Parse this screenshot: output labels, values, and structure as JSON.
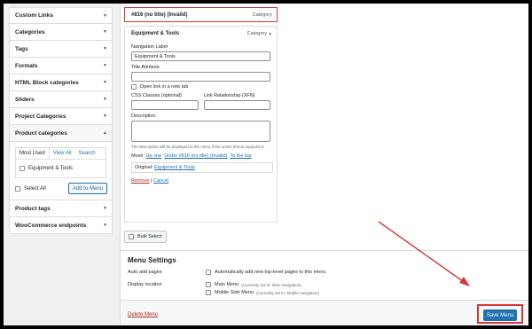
{
  "left_panel": {
    "items": [
      {
        "label": "Custom Links"
      },
      {
        "label": "Categories"
      },
      {
        "label": "Tags"
      },
      {
        "label": "Formats"
      },
      {
        "label": "HTML Block categories"
      },
      {
        "label": "Sliders"
      },
      {
        "label": "Project Categories"
      }
    ],
    "product_categories": {
      "label": "Product categories",
      "tabs": [
        "Most Used",
        "View All",
        "Search"
      ],
      "option": "Equipment & Tools",
      "select_all": "Select All",
      "add_button": "Add to Menu"
    },
    "after_items": [
      {
        "label": "Product tags"
      },
      {
        "label": "WooCommerce endpoints"
      }
    ]
  },
  "menu_structure": {
    "invalid_item": {
      "title": "#816 (no title) (Invalid)",
      "type": "Category"
    },
    "item": {
      "title": "Equipment & Tools",
      "type": "Category"
    },
    "nav_label": {
      "label": "Navigation Label",
      "value": "Equipment & Tools"
    },
    "title_attr": {
      "label": "Title Attribute",
      "value": ""
    },
    "new_tab": "Open link in a new tab",
    "css_classes": {
      "label": "CSS Classes (optional)",
      "value": ""
    },
    "xfn": {
      "label": "Link Relationship (XFN)",
      "value": ""
    },
    "description": {
      "label": "Description",
      "value": "",
      "hint": "The description will be displayed in the menu if the active theme supports it."
    },
    "move": {
      "label": "Move",
      "links": [
        "Up one",
        "Under #816 (no title) (Invalid)",
        "To the top"
      ]
    },
    "original": {
      "label": "Original:",
      "link": "Equipment & Tools"
    },
    "remove": "Remove",
    "sep": "|",
    "cancel": "Cancel",
    "bulk_select": "Bulk Select"
  },
  "menu_settings": {
    "title": "Menu Settings",
    "auto_add_label": "Auto add pages",
    "auto_add_option": "Automatically add new top-level pages to this menu",
    "display_label": "Display location",
    "locations": [
      {
        "name": "Main Menu",
        "note": "(Currently set to: Main navigation)"
      },
      {
        "name": "Mobile Side Menu",
        "note": "(Currently set to: Mobile navigation)"
      }
    ]
  },
  "footer": {
    "delete": "Delete Menu",
    "save": "Save Menu"
  },
  "colors": {
    "accent": "#2271b1",
    "highlight": "#d63638"
  }
}
